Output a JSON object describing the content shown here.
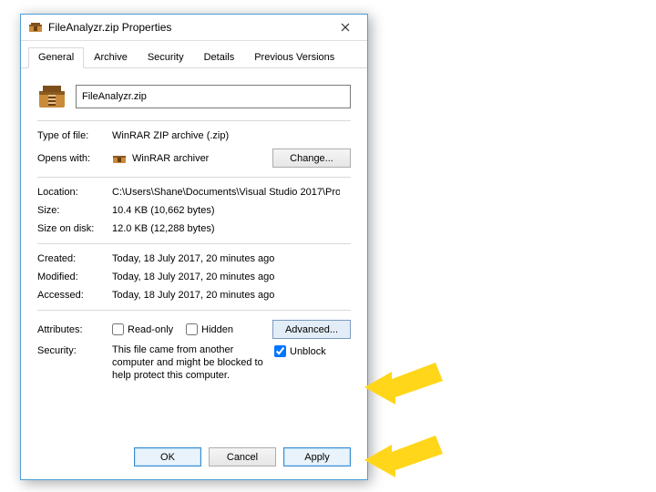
{
  "window": {
    "title": "FileAnalyzr.zip Properties"
  },
  "tabs": [
    "General",
    "Archive",
    "Security",
    "Details",
    "Previous Versions"
  ],
  "file": {
    "name": "FileAnalyzr.zip",
    "type_label": "Type of file:",
    "type_value": "WinRAR ZIP archive (.zip)",
    "opens_label": "Opens with:",
    "opens_value": "WinRAR archiver",
    "change_btn": "Change...",
    "location_label": "Location:",
    "location_value": "C:\\Users\\Shane\\Documents\\Visual Studio 2017\\Pro",
    "size_label": "Size:",
    "size_value": "10.4 KB (10,662 bytes)",
    "sizeondisk_label": "Size on disk:",
    "sizeondisk_value": "12.0 KB (12,288 bytes)",
    "created_label": "Created:",
    "created_value": "Today, 18 July 2017, 20 minutes ago",
    "modified_label": "Modified:",
    "modified_value": "Today, 18 July 2017, 20 minutes ago",
    "accessed_label": "Accessed:",
    "accessed_value": "Today, 18 July 2017, 20 minutes ago"
  },
  "attributes": {
    "label": "Attributes:",
    "readonly": "Read-only",
    "hidden": "Hidden",
    "advanced_btn": "Advanced..."
  },
  "security": {
    "label": "Security:",
    "message": "This file came from another computer and might be blocked to help protect this computer.",
    "unblock": "Unblock"
  },
  "buttons": {
    "ok": "OK",
    "cancel": "Cancel",
    "apply": "Apply"
  }
}
